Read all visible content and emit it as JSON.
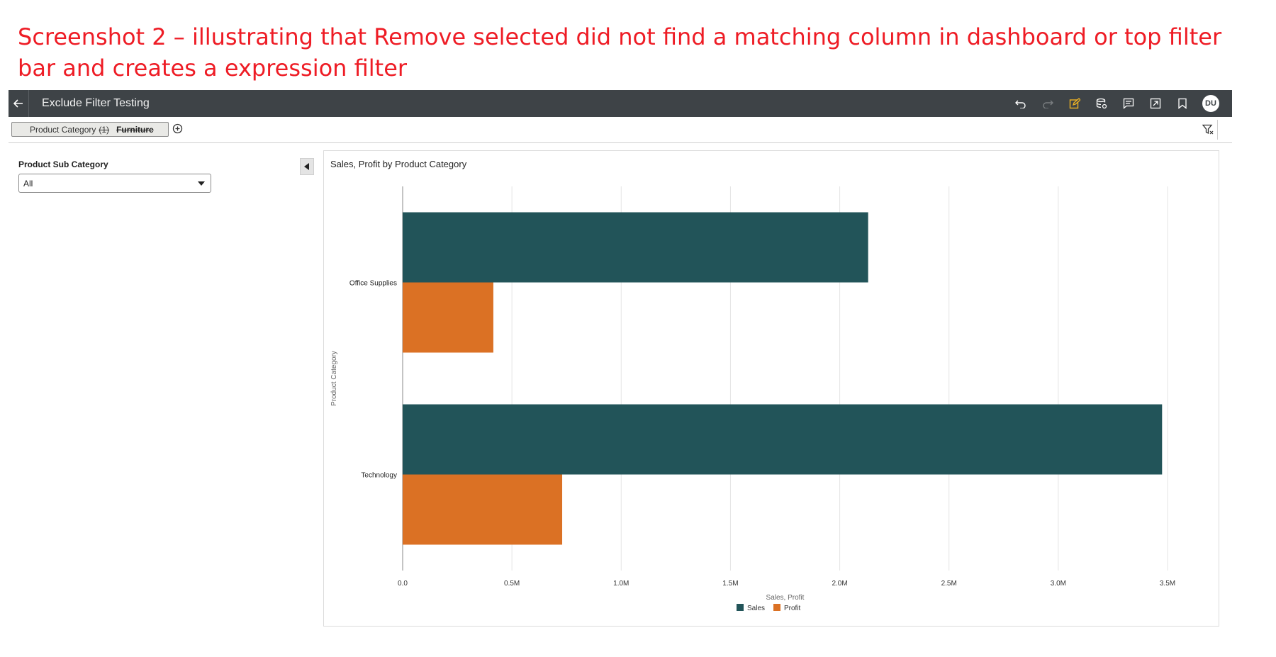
{
  "caption": "Screenshot 2 – illustrating that Remove selected did not find a matching column in dashboard or top filter bar and creates a expression filter",
  "topbar": {
    "title": "Exclude Filter Testing",
    "avatar_initials": "DU",
    "icons": [
      "back-arrow-icon",
      "undo-icon",
      "redo-icon",
      "edit-icon",
      "data-icon",
      "comments-icon",
      "export-icon",
      "bookmark-icon"
    ],
    "edit_icon_color": "#f0b323",
    "background": "#3e4347"
  },
  "filterbar": {
    "pill_label": "Product Category",
    "pill_count": "(1)",
    "pill_value": "Furniture"
  },
  "left_panel": {
    "label": "Product Sub Category",
    "select_value": "All"
  },
  "chart": {
    "title": "Sales, Profit by Product Category"
  },
  "chart_data": {
    "type": "bar",
    "orientation": "horizontal",
    "categories": [
      "Office Supplies",
      "Technology"
    ],
    "series": [
      {
        "name": "Sales",
        "color": "#225459",
        "values": [
          2130000,
          3475000
        ]
      },
      {
        "name": "Profit",
        "color": "#db7124",
        "values": [
          415000,
          730000
        ]
      }
    ],
    "xlabel": "Sales, Profit",
    "ylabel": "Product Category",
    "xlim": [
      0,
      3500000
    ],
    "xticks": [
      0,
      500000,
      1000000,
      1500000,
      2000000,
      2500000,
      3000000,
      3500000
    ],
    "xtick_labels": [
      "0.0",
      "0.5M",
      "1.0M",
      "1.5M",
      "2.0M",
      "2.5M",
      "3.0M",
      "3.5M"
    ],
    "grid": true,
    "legend": "bottom-center"
  }
}
